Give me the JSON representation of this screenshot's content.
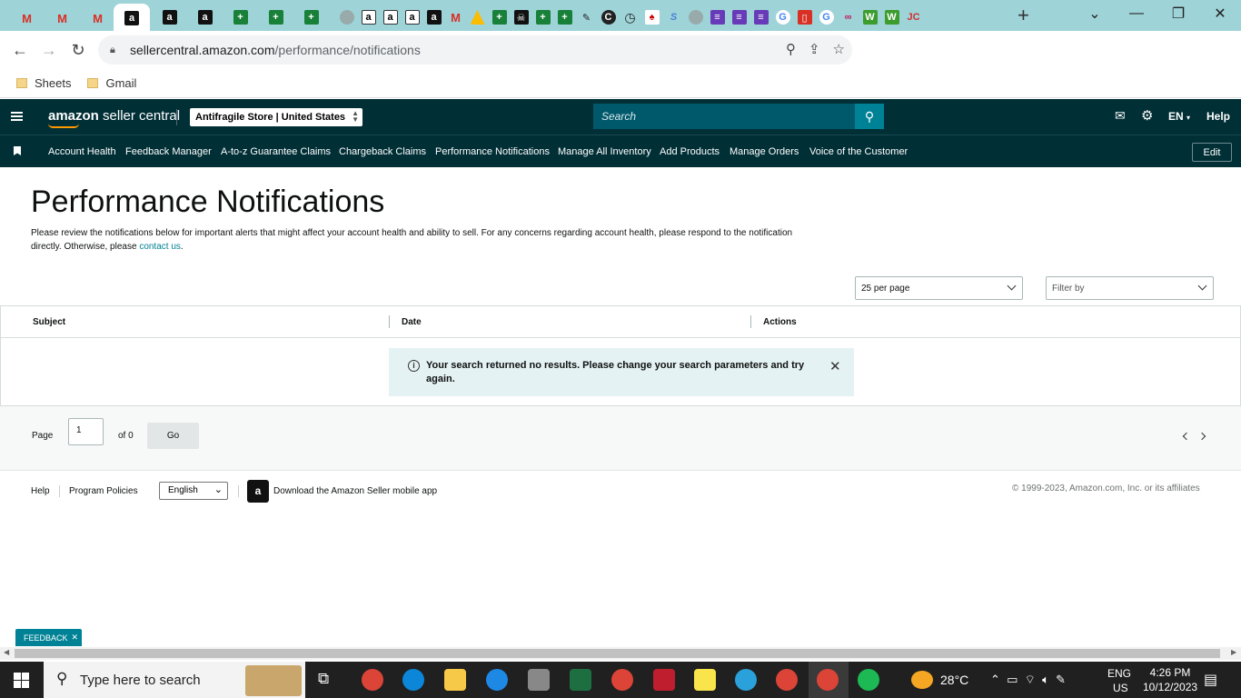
{
  "browser": {
    "url_host": "sellercentral.amazon.com",
    "url_path": "/performance/notifications",
    "bookmarks": [
      "Sheets",
      "Gmail"
    ]
  },
  "header": {
    "logo_bold": "amazon",
    "logo_rest": " seller central",
    "store": "Antifragile Store | United States",
    "search_placeholder": "Search",
    "lang": "EN",
    "help": "Help"
  },
  "nav": {
    "links": [
      "Account Health",
      "Feedback Manager",
      "A-to-z Guarantee Claims",
      "Chargeback Claims",
      "Performance Notifications",
      "Manage All Inventory",
      "Add Products",
      "Manage Orders",
      "Voice of the Customer"
    ],
    "edit": "Edit"
  },
  "main": {
    "title": "Performance Notifications",
    "description": "Please review the notifications below for important alerts that might affect your account health and ability to sell. For any concerns regarding account health, please respond to the notification directly. Otherwise, please ",
    "contact_link": "contact us",
    "per_page": "25 per page",
    "filter": "Filter by",
    "columns": [
      "Subject",
      "Date",
      "Actions"
    ],
    "alert": "Your search returned no results. Please change your search parameters and try again."
  },
  "pager": {
    "page_label": "Page",
    "page_value": "1",
    "of_label": "of 0",
    "go": "Go"
  },
  "footer": {
    "help": "Help",
    "policies": "Program Policies",
    "language": "English",
    "app_text": "Download the Amazon Seller mobile app",
    "copyright": "© 1999-2023, Amazon.com, Inc. or its affiliates"
  },
  "feedback": "FEEDBACK",
  "taskbar": {
    "search": "Type here to search",
    "weather": "28°C",
    "lang1": "ENG",
    "lang2": "US",
    "time": "4:26 PM",
    "date": "10/12/2023"
  }
}
